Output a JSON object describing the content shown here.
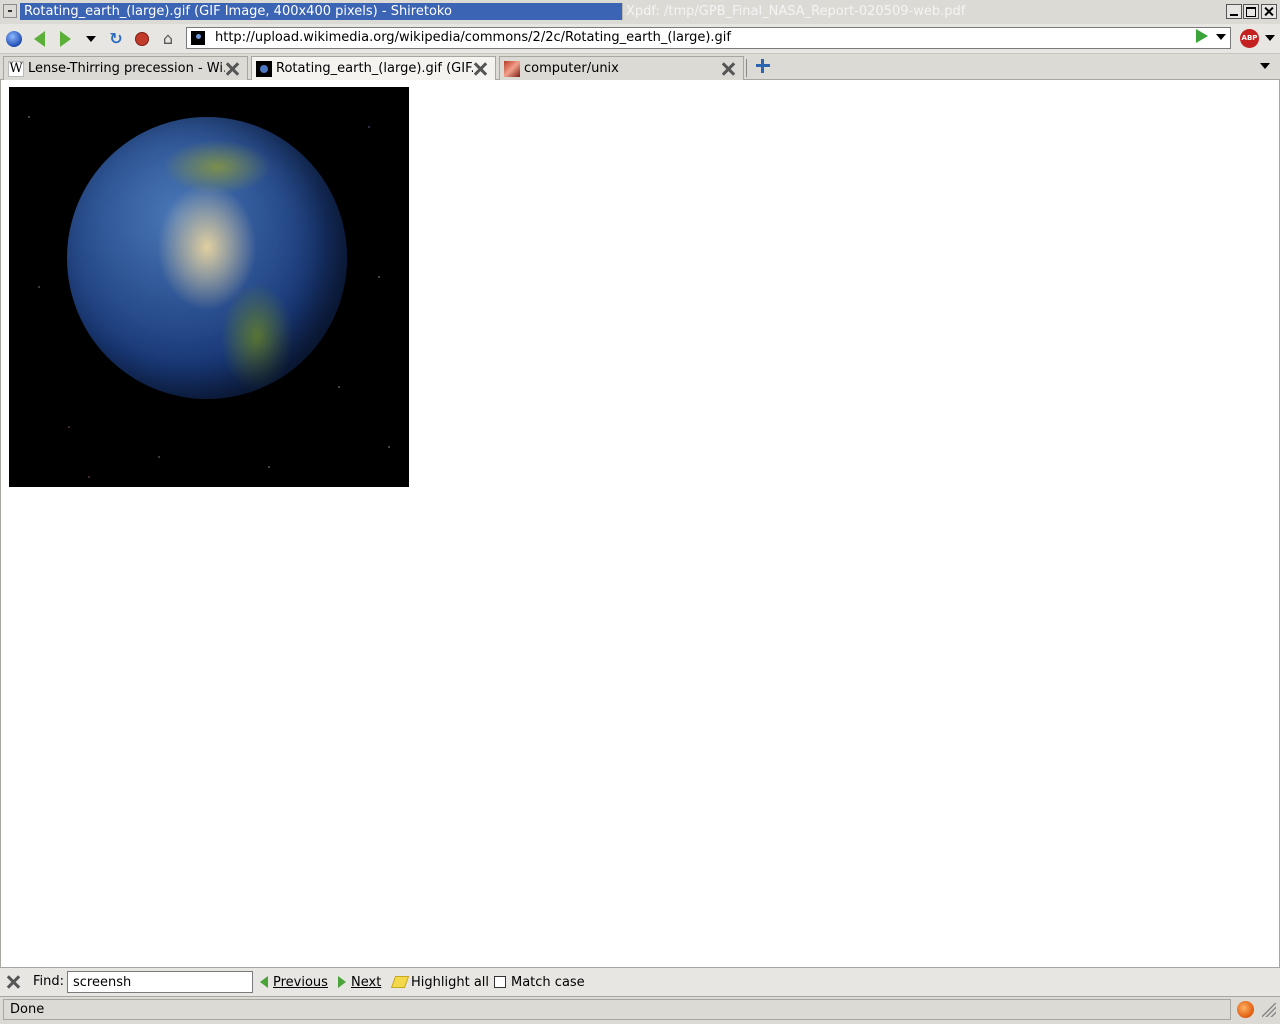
{
  "window": {
    "active_title": "Rotating_earth_(large).gif (GIF Image, 400x400 pixels) - Shiretoko",
    "inactive_title": "Xpdf: /tmp/GPB_Final_NASA_Report-020509-web.pdf"
  },
  "navbar": {
    "url": "http://upload.wikimedia.org/wikipedia/commons/2/2c/Rotating_earth_(large).gif",
    "icons": [
      "globe-icon",
      "back-icon",
      "forward-icon",
      "history-dropdown-icon",
      "reload-icon",
      "stop-icon",
      "home-icon",
      "go-icon",
      "adblock-icon"
    ],
    "adblock_label": "ABP"
  },
  "tabs": [
    {
      "label": "Lense-Thirring precession - Wi...",
      "icon": "wikipedia-favicon",
      "active": false
    },
    {
      "label": "Rotating_earth_(large).gif (GIF...",
      "icon": "earth-favicon",
      "active": true
    },
    {
      "label": "computer/unix",
      "icon": "red-favicon",
      "active": false
    }
  ],
  "content": {
    "image_alt": "Rotating earth",
    "image_colors": {
      "space": "#000000",
      "ocean": "#1a3a7a",
      "land": "#d6c396"
    }
  },
  "findbar": {
    "label": "Find:",
    "value": "screensh",
    "previous_label": "Previous",
    "next_label": "Next",
    "highlight_label": "Highlight all",
    "match_case_label": "Match case",
    "match_case_checked": false
  },
  "statusbar": {
    "text": "Done"
  }
}
